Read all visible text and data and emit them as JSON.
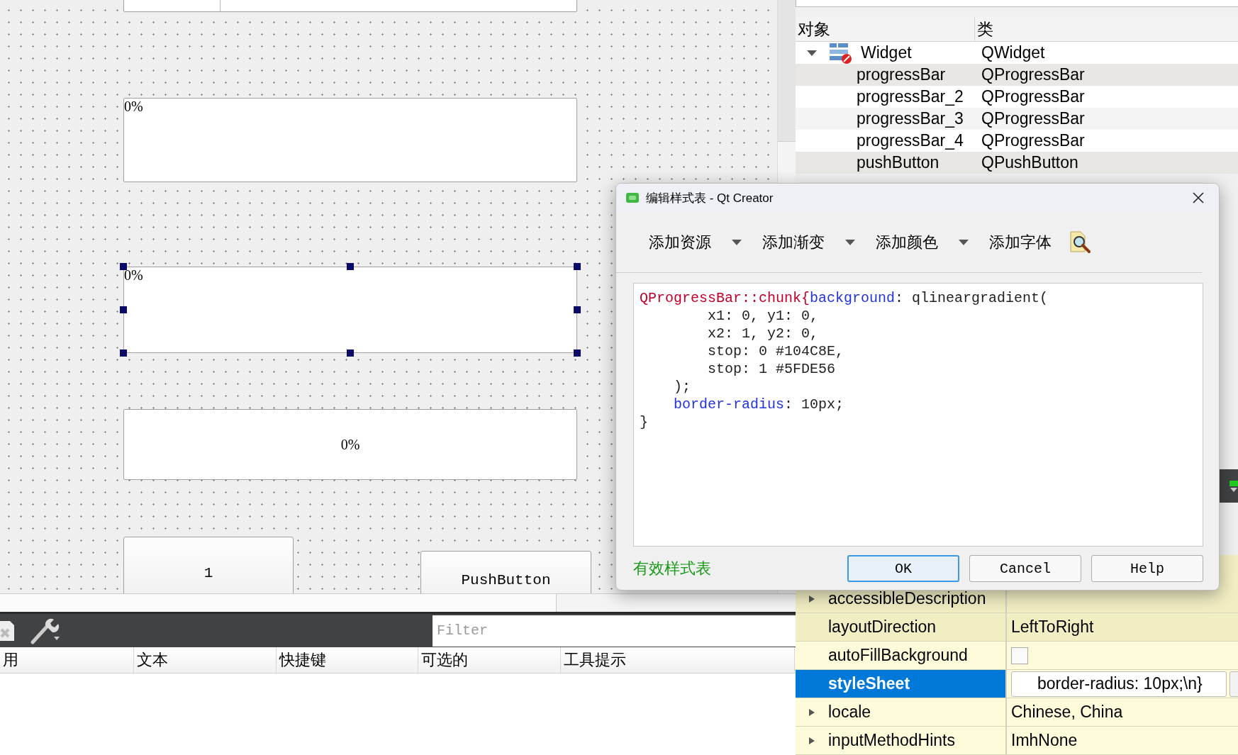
{
  "canvas": {
    "widgets": [
      {
        "kind": "lineedit"
      },
      {
        "kind": "progress",
        "text": "0%",
        "selected": false
      },
      {
        "kind": "progress",
        "text": "0%",
        "selected": true
      },
      {
        "kind": "progress",
        "text": "0%",
        "selected": false
      },
      {
        "kind": "button",
        "text": "1"
      },
      {
        "kind": "button",
        "text": "PushButton"
      }
    ]
  },
  "action_editor": {
    "filter_placeholder": "Filter",
    "columns": [
      "用",
      "文本",
      "快捷键",
      "可选的",
      "工具提示"
    ]
  },
  "object_inspector": {
    "columns": [
      "对象",
      "类"
    ],
    "tree": [
      {
        "name": "Widget",
        "class": "QWidget",
        "expanded": true,
        "children": [
          {
            "name": "progressBar",
            "class": "QProgressBar"
          },
          {
            "name": "progressBar_2",
            "class": "QProgressBar"
          },
          {
            "name": "progressBar_3",
            "class": "QProgressBar"
          },
          {
            "name": "progressBar_4",
            "class": "QProgressBar"
          },
          {
            "name": "pushButton",
            "class": "QPushButton"
          }
        ]
      }
    ]
  },
  "property_editor": {
    "rows": [
      {
        "name": "accessibleDescription",
        "kind": "text",
        "value": "",
        "expandable": true,
        "selected": false
      },
      {
        "name": "layoutDirection",
        "kind": "text",
        "value": "LeftToRight",
        "expandable": false,
        "selected": false
      },
      {
        "name": "autoFillBackground",
        "kind": "checkbox",
        "checked": false,
        "expandable": false,
        "selected": false
      },
      {
        "name": "styleSheet",
        "kind": "text",
        "value": "border-radius: 10px;\\n}",
        "expandable": false,
        "selected": true
      },
      {
        "name": "locale",
        "kind": "text",
        "value": "Chinese, China",
        "expandable": true,
        "selected": false
      },
      {
        "name": "inputMethodHints",
        "kind": "text",
        "value": "ImhNone",
        "expandable": true,
        "selected": false
      }
    ]
  },
  "dialog": {
    "title": "编辑样式表 - Qt Creator",
    "toolbar": [
      {
        "label": "添加资源",
        "dropdown": true
      },
      {
        "label": "添加渐变",
        "dropdown": true
      },
      {
        "label": "添加颜色",
        "dropdown": true
      },
      {
        "label": "添加字体",
        "dropdown": false
      }
    ],
    "code": [
      [
        {
          "t": "QProgressBar::chunk{",
          "kind": "selector"
        },
        {
          "t": "background",
          "kind": "property"
        },
        {
          "t": ": qlineargradient(",
          "kind": "plain"
        }
      ],
      [
        {
          "t": "        x1: 0, y1: 0,",
          "kind": "plain"
        }
      ],
      [
        {
          "t": "        x2: 1, y2: 0,",
          "kind": "plain"
        }
      ],
      [
        {
          "t": "        stop: 0 #104C8E,",
          "kind": "plain"
        }
      ],
      [
        {
          "t": "        stop: 1 #5FDE56",
          "kind": "plain"
        }
      ],
      [
        {
          "t": "    );",
          "kind": "plain"
        }
      ],
      [
        {
          "t": "    border-radius",
          "kind": "property"
        },
        {
          "t": ": 10px;",
          "kind": "plain"
        }
      ],
      [
        {
          "t": "}",
          "kind": "plain"
        }
      ]
    ],
    "status": "有效样式表",
    "buttons": [
      {
        "label": "OK",
        "default": true
      },
      {
        "label": "Cancel",
        "default": false
      },
      {
        "label": "Help",
        "default": false
      }
    ]
  }
}
